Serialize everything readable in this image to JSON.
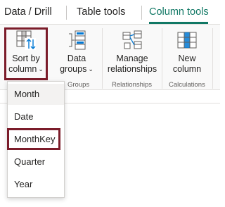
{
  "tabs": [
    {
      "label": "Data / Drill",
      "active": false
    },
    {
      "label": "Table tools",
      "active": false
    },
    {
      "label": "Column tools",
      "active": true
    }
  ],
  "ribbon": {
    "sort_by_column": {
      "line1": "Sort by",
      "line2": "column",
      "icon": "sort-by-column-icon"
    },
    "data_groups": {
      "line1": "Data",
      "line2": "groups",
      "icon": "data-groups-icon"
    },
    "manage_relationships": {
      "line1": "Manage",
      "line2": "relationships",
      "icon": "manage-relationships-icon"
    },
    "new_column": {
      "line1": "New",
      "line2": "column",
      "icon": "new-column-icon"
    },
    "group_labels": {
      "groups": "Groups",
      "relationships": "Relationships",
      "calculations": "Calculations"
    }
  },
  "dropdown": {
    "options": [
      "Month",
      "Date",
      "MonthKey",
      "Quarter",
      "Year"
    ],
    "selected": "Month",
    "highlighted": "MonthKey"
  },
  "colors": {
    "accent": "#117865",
    "highlight_box": "#7b1c2a",
    "ribbon_background": "#f9f9f9"
  }
}
